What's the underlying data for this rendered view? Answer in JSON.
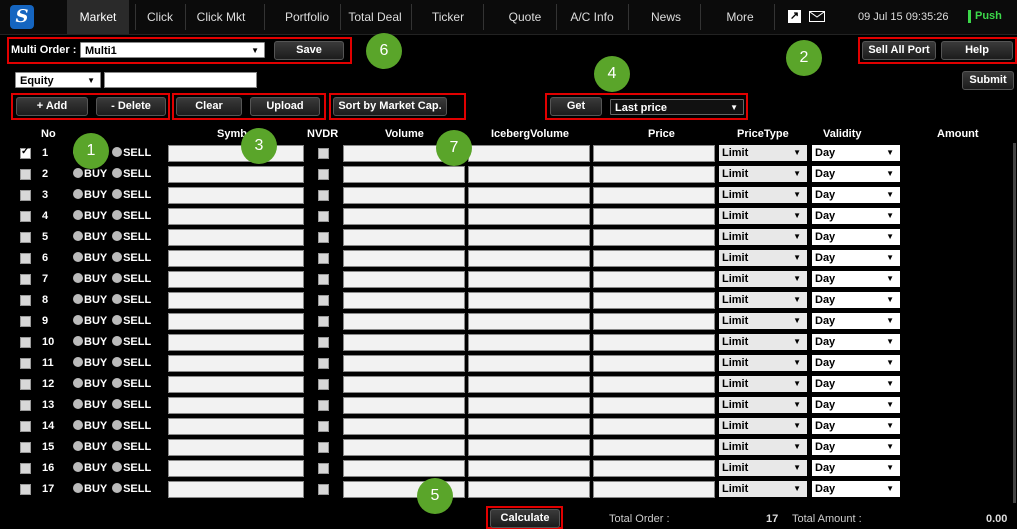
{
  "nav": {
    "tabs": [
      "Market",
      "Click",
      "Click Mkt",
      "Portfolio",
      "Total Deal",
      "Ticker",
      "Quote",
      "A/C Info",
      "News",
      "More"
    ],
    "datetime": "09 Jul 15  09:35:26",
    "push_label": "Push"
  },
  "multi_order": {
    "label": "Multi Order :",
    "selected": "Multi1",
    "save": "Save"
  },
  "right_buttons": {
    "sell_all_port": "Sell All Port",
    "help": "Help",
    "submit": "Submit"
  },
  "market_select": {
    "selected": "Equity",
    "filter_value": ""
  },
  "toolbar": {
    "add": "+ Add",
    "delete": "- Delete",
    "clear": "Clear",
    "upload": "Upload",
    "sort": "Sort by Market Cap.",
    "get": "Get",
    "price_select": "Last price"
  },
  "table": {
    "headers": {
      "no": "No",
      "symbol": "Symb",
      "nvdr": "NVDR",
      "volume": "Volume",
      "iceberg": "IcebergVolume",
      "price": "Price",
      "price_type": "PriceType",
      "validity": "Validity",
      "amount": "Amount"
    },
    "buy_label": "BUY",
    "sell_label": "SELL",
    "rows": [
      {
        "no": "1",
        "checked": true,
        "price_type": "Limit",
        "validity": "Day"
      },
      {
        "no": "2",
        "checked": false,
        "price_type": "Limit",
        "validity": "Day"
      },
      {
        "no": "3",
        "checked": false,
        "price_type": "Limit",
        "validity": "Day"
      },
      {
        "no": "4",
        "checked": false,
        "price_type": "Limit",
        "validity": "Day"
      },
      {
        "no": "5",
        "checked": false,
        "price_type": "Limit",
        "validity": "Day"
      },
      {
        "no": "6",
        "checked": false,
        "price_type": "Limit",
        "validity": "Day"
      },
      {
        "no": "7",
        "checked": false,
        "price_type": "Limit",
        "validity": "Day"
      },
      {
        "no": "8",
        "checked": false,
        "price_type": "Limit",
        "validity": "Day"
      },
      {
        "no": "9",
        "checked": false,
        "price_type": "Limit",
        "validity": "Day"
      },
      {
        "no": "10",
        "checked": false,
        "price_type": "Limit",
        "validity": "Day"
      },
      {
        "no": "11",
        "checked": false,
        "price_type": "Limit",
        "validity": "Day"
      },
      {
        "no": "12",
        "checked": false,
        "price_type": "Limit",
        "validity": "Day"
      },
      {
        "no": "13",
        "checked": false,
        "price_type": "Limit",
        "validity": "Day"
      },
      {
        "no": "14",
        "checked": false,
        "price_type": "Limit",
        "validity": "Day"
      },
      {
        "no": "15",
        "checked": false,
        "price_type": "Limit",
        "validity": "Day"
      },
      {
        "no": "16",
        "checked": false,
        "price_type": "Limit",
        "validity": "Day"
      },
      {
        "no": "17",
        "checked": false,
        "price_type": "Limit",
        "validity": "Day"
      }
    ]
  },
  "footer": {
    "calculate": "Calculate",
    "total_order_label": "Total Order :",
    "total_order_value": "17",
    "total_amount_label": "Total Amount :",
    "total_amount_value": "0.00"
  },
  "callouts": [
    "1",
    "2",
    "3",
    "4",
    "5",
    "6",
    "7"
  ],
  "colors": {
    "highlight_red": "#e10000",
    "callout_green": "#5aa52a",
    "push_green": "#3cd84a"
  }
}
